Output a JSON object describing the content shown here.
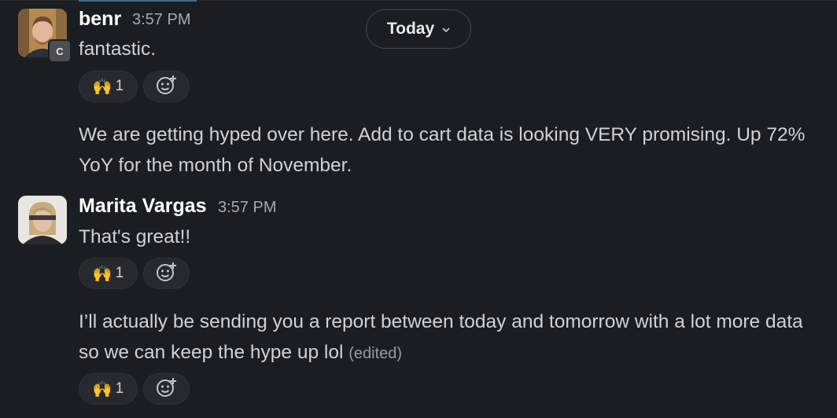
{
  "date_divider": {
    "label": "Today",
    "chevron_icon": "chevron-down-icon"
  },
  "messages": [
    {
      "author": "benr",
      "time": "3:57 PM",
      "avatar_badge": "C",
      "text": "fantastic.",
      "reaction": {
        "emoji": "🙌",
        "count": "1",
        "icon": "raised-hands-emoji"
      }
    },
    {
      "text": "We are getting hyped over here. Add to cart data is looking VERY promising. Up 72% YoY for the month of November."
    },
    {
      "author": "Marita Vargas",
      "time": "3:57 PM",
      "text": "That's great!!",
      "reaction": {
        "emoji": "🙌",
        "count": "1",
        "icon": "raised-hands-emoji"
      }
    },
    {
      "text": "I’ll actually be sending you a report between today and tomorrow with a lot more data so we can keep the hype up lol",
      "edited": "(edited)",
      "reaction": {
        "emoji": "🙌",
        "count": "1",
        "icon": "raised-hands-emoji"
      }
    }
  ],
  "colors": {
    "background": "#1a1d21",
    "text": "#d1d2d3",
    "muted": "#a9aaab",
    "pill": "#26292d"
  }
}
